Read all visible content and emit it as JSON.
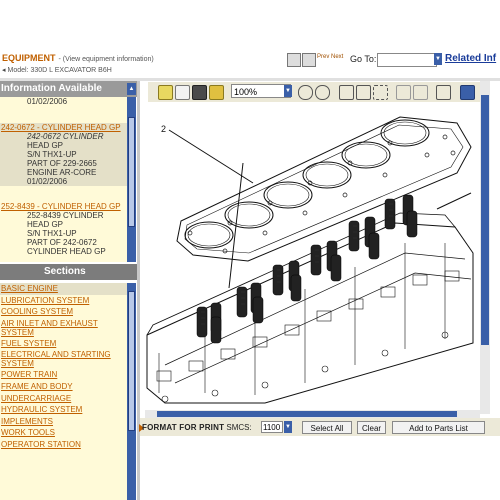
{
  "header": {
    "title": "EQUIPMENT",
    "subtitle": "- (View equipment information)",
    "model": "Model: 330D L EXCAVATOR B6H",
    "prev_next": "Prev Next",
    "goto_label": "Go To:",
    "goto_value": "",
    "related_label": "Related Inf"
  },
  "info_panel": {
    "heading": "Information Available",
    "items": [
      {
        "lines": [
          "01/02/2006"
        ],
        "link": ""
      },
      {
        "link": "242-0672 - CYLINDER HEAD GP",
        "lines": [
          "242-0672 CYLINDER",
          "HEAD GP",
          "S/N THX1-UP",
          "PART OF 229-2665",
          "ENGINE AR-CORE",
          "01/02/2006"
        ]
      },
      {
        "link": "252-8439 - CYLINDER HEAD GP",
        "lines": [
          "252-8439 CYLINDER",
          "HEAD GP",
          "S/N THX1-UP",
          "PART OF 242-0672",
          "CYLINDER HEAD GP"
        ]
      }
    ]
  },
  "sections_panel": {
    "heading": "Sections",
    "items": [
      "BASIC ENGINE",
      "LUBRICATION SYSTEM",
      "COOLING SYSTEM",
      "AIR INLET AND EXHAUST SYSTEM",
      "FUEL SYSTEM",
      "ELECTRICAL AND STARTING SYSTEM",
      "POWER TRAIN",
      "FRAME AND BODY",
      "UNDERCARRIAGE",
      "HYDRAULIC SYSTEM",
      "IMPLEMENTS",
      "WORK TOOLS",
      "OPERATOR STATION"
    ]
  },
  "viewer": {
    "zoom": "100%",
    "callout_label": "2"
  },
  "bottom_bar": {
    "format_label": "FORMAT FOR PRINT",
    "smcs_label": "SMCS:",
    "smcs_value": "1100",
    "select_all": "Select All",
    "clear": "Clear",
    "add_to_parts": "Add to Parts List"
  }
}
